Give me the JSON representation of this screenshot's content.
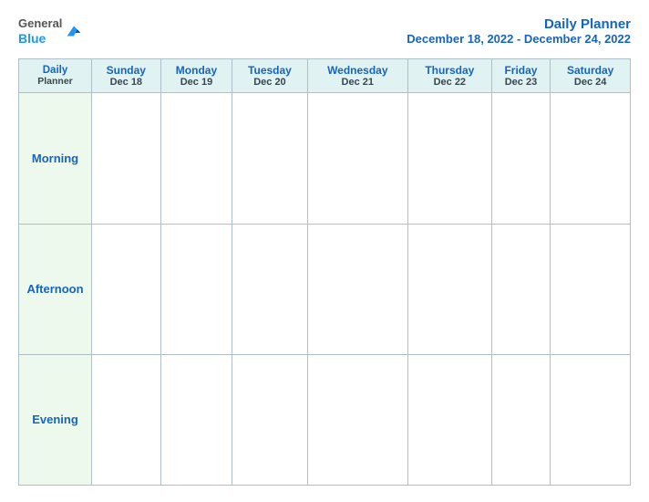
{
  "header": {
    "logo": {
      "general": "General",
      "blue": "Blue"
    },
    "title": "Daily Planner",
    "date_range": "December 18, 2022 - December 24, 2022"
  },
  "table": {
    "label_header": {
      "main": "Daily",
      "sub": "Planner"
    },
    "columns": [
      {
        "day": "Sunday",
        "date": "Dec 18"
      },
      {
        "day": "Monday",
        "date": "Dec 19"
      },
      {
        "day": "Tuesday",
        "date": "Dec 20"
      },
      {
        "day": "Wednesday",
        "date": "Dec 21"
      },
      {
        "day": "Thursday",
        "date": "Dec 22"
      },
      {
        "day": "Friday",
        "date": "Dec 23"
      },
      {
        "day": "Saturday",
        "date": "Dec 24"
      }
    ],
    "rows": [
      {
        "label": "Morning"
      },
      {
        "label": "Afternoon"
      },
      {
        "label": "Evening"
      }
    ]
  }
}
